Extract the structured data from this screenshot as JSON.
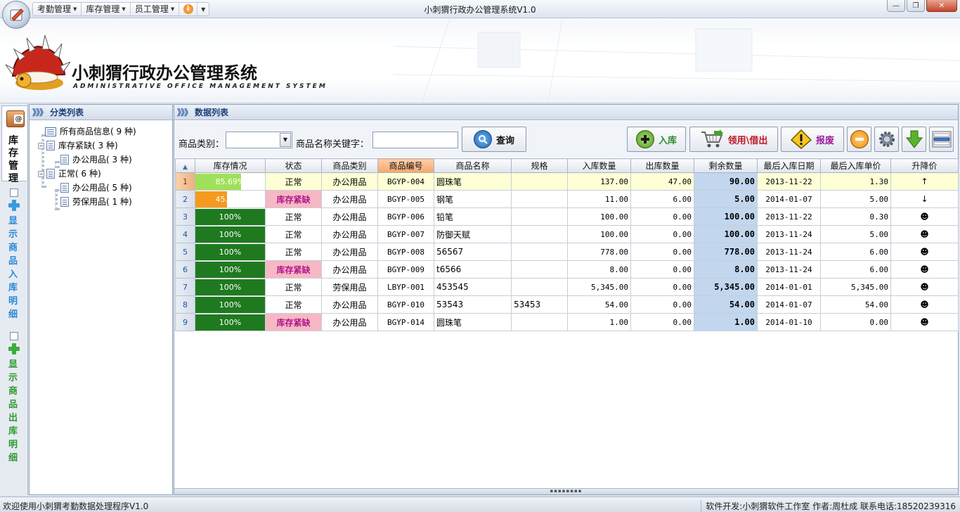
{
  "window": {
    "title": "小刺猬行政办公管理系统V1.0"
  },
  "menu": {
    "items": [
      {
        "label": "考勤管理"
      },
      {
        "label": "库存管理"
      },
      {
        "label": "员工管理"
      }
    ],
    "help_glyph": "i"
  },
  "banner": {
    "title": "小刺猬行政办公管理系统",
    "subtitle": "ADMINISTRATIVE OFFICE MANAGEMENT SYSTEM"
  },
  "rail": {
    "active_tab": "库存管理",
    "options": [
      {
        "label": "显示商品入库明细",
        "checked": false
      },
      {
        "label": "显示商品出库明细",
        "checked": false
      }
    ]
  },
  "category_panel": {
    "title": "分类列表",
    "tree": {
      "root": "所有商品信息( 9 种)",
      "groups": [
        {
          "label": "库存紧缺( 3 种)",
          "children": [
            "办公用品( 3 种)"
          ]
        },
        {
          "label": "正常( 6 种)",
          "children": [
            "办公用品( 5 种)",
            "劳保用品( 1 种)"
          ]
        }
      ]
    }
  },
  "data_panel": {
    "title": "数据列表",
    "filter": {
      "category_label": "商品类别：",
      "category_value": "",
      "keyword_label": "商品名称关键字：",
      "keyword_value": ""
    },
    "buttons": {
      "search": "查询",
      "stock_in": "入库",
      "borrow": "领用\\借出",
      "scrap": "报废"
    },
    "colors": {
      "stock_in": "#2e8b2e",
      "borrow": "#c0182a",
      "scrap": "#9b1a9b",
      "short_bg": "#f6b8c3",
      "bar_full": "#1f7a1f",
      "bar_high": "#9fe05a",
      "bar_low": "#f59a1e"
    }
  },
  "table": {
    "columns": [
      "库存情况",
      "状态",
      "商品类别",
      "商品编号",
      "商品名称",
      "规格",
      "入库数量",
      "出库数量",
      "剩余数量",
      "最后入库日期",
      "最后入库单价",
      "升降价"
    ],
    "rows": [
      {
        "idx": "1",
        "stock_pct": "85.69%",
        "stock_level": 0.6569,
        "status": "正常",
        "category": "办公用品",
        "code": "BGYP-004",
        "name": "圆珠笔",
        "spec": "",
        "in_qty": "137.00",
        "out_qty": "47.00",
        "remain": "90.00",
        "last_date": "2013-11-22",
        "last_price": "1.30",
        "trend": "↑"
      },
      {
        "idx": "2",
        "stock_pct": "45.45%",
        "stock_level": 0.4545,
        "status": "库存紧缺",
        "category": "办公用品",
        "code": "BGYP-005",
        "name": "钢笔",
        "spec": "",
        "in_qty": "11.00",
        "out_qty": "6.00",
        "remain": "5.00",
        "last_date": "2014-01-07",
        "last_price": "5.00",
        "trend": "↓"
      },
      {
        "idx": "3",
        "stock_pct": "100%",
        "stock_level": 1,
        "status": "正常",
        "category": "办公用品",
        "code": "BGYP-006",
        "name": "铅笔",
        "spec": "",
        "in_qty": "100.00",
        "out_qty": "0.00",
        "remain": "100.00",
        "last_date": "2013-11-22",
        "last_price": "0.30",
        "trend": "☻"
      },
      {
        "idx": "4",
        "stock_pct": "100%",
        "stock_level": 1,
        "status": "正常",
        "category": "办公用品",
        "code": "BGYP-007",
        "name": "防御天赋",
        "spec": "",
        "in_qty": "100.00",
        "out_qty": "0.00",
        "remain": "100.00",
        "last_date": "2013-11-24",
        "last_price": "5.00",
        "trend": "☻"
      },
      {
        "idx": "5",
        "stock_pct": "100%",
        "stock_level": 1,
        "status": "正常",
        "category": "办公用品",
        "code": "BGYP-008",
        "name": "56567",
        "spec": "",
        "in_qty": "778.00",
        "out_qty": "0.00",
        "remain": "778.00",
        "last_date": "2013-11-24",
        "last_price": "6.00",
        "trend": "☻"
      },
      {
        "idx": "6",
        "stock_pct": "100%",
        "stock_level": 1,
        "status": "库存紧缺",
        "category": "办公用品",
        "code": "BGYP-009",
        "name": "t6566",
        "spec": "",
        "in_qty": "8.00",
        "out_qty": "0.00",
        "remain": "8.00",
        "last_date": "2013-11-24",
        "last_price": "6.00",
        "trend": "☻"
      },
      {
        "idx": "7",
        "stock_pct": "100%",
        "stock_level": 1,
        "status": "正常",
        "category": "劳保用品",
        "code": "LBYP-001",
        "name": "453545",
        "spec": "",
        "in_qty": "5,345.00",
        "out_qty": "0.00",
        "remain": "5,345.00",
        "last_date": "2014-01-01",
        "last_price": "5,345.00",
        "trend": "☻"
      },
      {
        "idx": "8",
        "stock_pct": "100%",
        "stock_level": 1,
        "status": "正常",
        "category": "办公用品",
        "code": "BGYP-010",
        "name": "53543",
        "spec": "53453",
        "in_qty": "54.00",
        "out_qty": "0.00",
        "remain": "54.00",
        "last_date": "2014-01-07",
        "last_price": "54.00",
        "trend": "☻"
      },
      {
        "idx": "9",
        "stock_pct": "100%",
        "stock_level": 1,
        "status": "库存紧缺",
        "category": "办公用品",
        "code": "BGYP-014",
        "name": "圆珠笔",
        "spec": "",
        "in_qty": "1.00",
        "out_qty": "0.00",
        "remain": "1.00",
        "last_date": "2014-01-10",
        "last_price": "0.00",
        "trend": "☻"
      }
    ]
  },
  "statusbar": {
    "left": "欢迎使用小刺猬考勤数据处理程序V1.0",
    "right": "软件开发:小刺猬软件工作室 作者:周杜成 联系电话:18520239316"
  }
}
